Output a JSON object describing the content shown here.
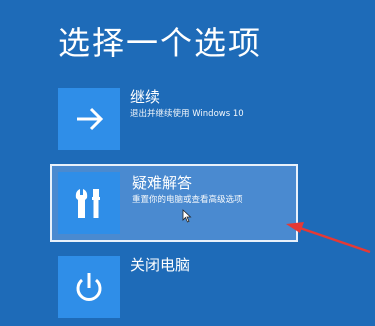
{
  "title": "选择一个选项",
  "options": [
    {
      "label": "继续",
      "description": "退出并继续使用 Windows 10",
      "icon": "arrow-right-icon"
    },
    {
      "label": "疑难解答",
      "description": "重置你的电脑或查看高级选项",
      "icon": "tools-icon"
    },
    {
      "label": "关闭电脑",
      "description": "",
      "icon": "power-icon"
    }
  ],
  "colors": {
    "background": "#1e6bb8",
    "tile": "#2f8ee8",
    "selected": "#4a8ad0",
    "annotation_arrow": "#e53935"
  }
}
